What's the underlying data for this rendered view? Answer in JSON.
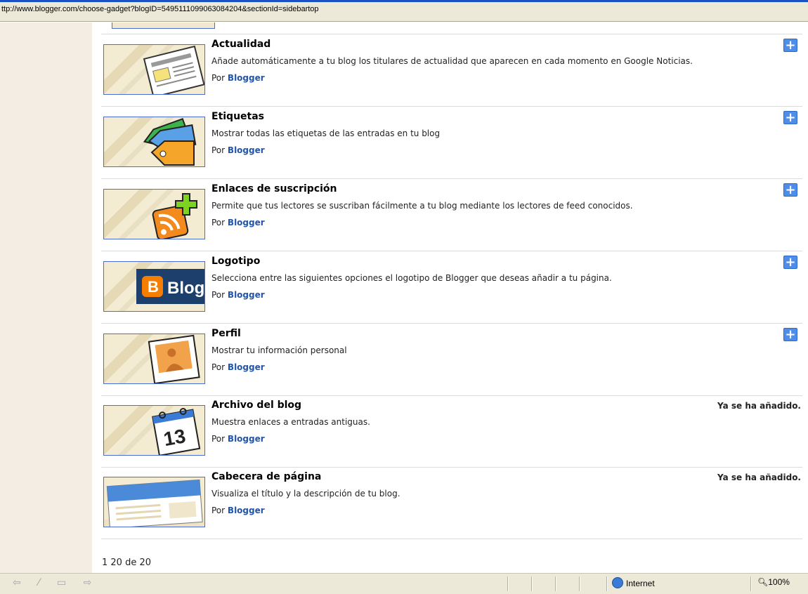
{
  "browser": {
    "url": "ttp://www.blogger.com/choose-gadget?blogID=5495111099063084204&sectionId=sidebartop",
    "status_zone": "Internet",
    "zoom": "100%"
  },
  "gadgets": [
    {
      "title": "Actualidad",
      "description": "Añade automáticamente a tu blog los titulares de actualidad que aparecen en cada momento en Google Noticias.",
      "by_label": "Por",
      "author": "Blogger",
      "added": false,
      "icon": "newspaper-icon"
    },
    {
      "title": "Etiquetas",
      "description": "Mostrar todas las etiquetas de las entradas en tu blog",
      "by_label": "Por",
      "author": "Blogger",
      "added": false,
      "icon": "tags-icon"
    },
    {
      "title": "Enlaces de suscripción",
      "description": "Permite que tus lectores se suscriban fácilmente a tu blog mediante los lectores de feed conocidos.",
      "by_label": "Por",
      "author": "Blogger",
      "added": false,
      "icon": "rss-feed-icon"
    },
    {
      "title": "Logotipo",
      "description": "Selecciona entre las siguientes opciones el logotipo de Blogger que deseas añadir a tu página.",
      "by_label": "Por",
      "author": "Blogger",
      "added": false,
      "icon": "blogger-logo-icon",
      "logo_text": "Blog"
    },
    {
      "title": "Perfil",
      "description": "Mostrar tu información personal",
      "by_label": "Por",
      "author": "Blogger",
      "added": false,
      "icon": "profile-photo-icon"
    },
    {
      "title": "Archivo del blog",
      "description": "Muestra enlaces a entradas antiguas.",
      "by_label": "Por",
      "author": "Blogger",
      "added": true,
      "added_label": "Ya se ha añadido.",
      "icon": "calendar-icon",
      "calendar_day": "13"
    },
    {
      "title": "Cabecera de página",
      "description": "Visualiza el título y la descripción de tu blog.",
      "by_label": "Por",
      "author": "Blogger",
      "added": true,
      "added_label": "Ya se ha añadido.",
      "icon": "page-header-icon"
    }
  ],
  "add_button_label": "+",
  "pager": "1 20 de 20",
  "colors": {
    "accent": "#4f8ee8",
    "link": "#2255aa",
    "sidebar_bg": "#f3ede4"
  }
}
